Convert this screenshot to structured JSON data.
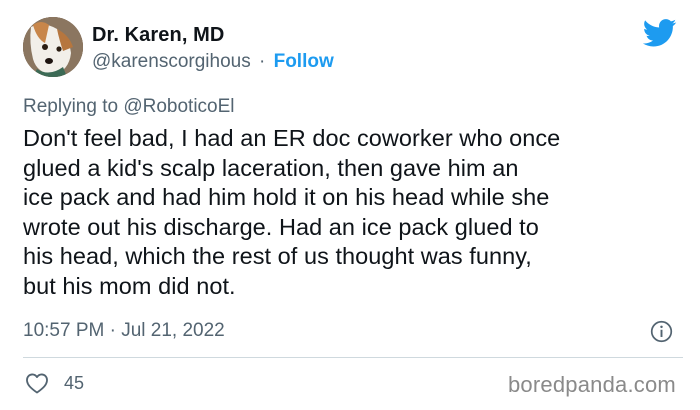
{
  "user": {
    "name": "Dr. Karen, MD",
    "handle": "@karenscorgihous",
    "separator": "·",
    "follow_label": "Follow",
    "avatar_icon": "corgi-avatar"
  },
  "reply": {
    "prefix": "Replying to ",
    "handle": "@RoboticoEl"
  },
  "tweet": {
    "lines": [
      "Don't feel bad, I had an ER doc coworker who once",
      "glued a kid's scalp laceration, then gave him an",
      "ice pack and had him hold it on his head while she",
      "wrote out his discharge. Had an ice pack glued to",
      "his head, which the rest of us thought was funny,",
      "but his mom did not."
    ]
  },
  "meta": {
    "timestamp": "10:57 PM · Jul 21, 2022"
  },
  "engagement": {
    "likes": "45"
  },
  "watermark": "boredpanda.com",
  "colors": {
    "accent": "#1d9bf0",
    "text": "#0f1419",
    "secondary": "#536471"
  }
}
